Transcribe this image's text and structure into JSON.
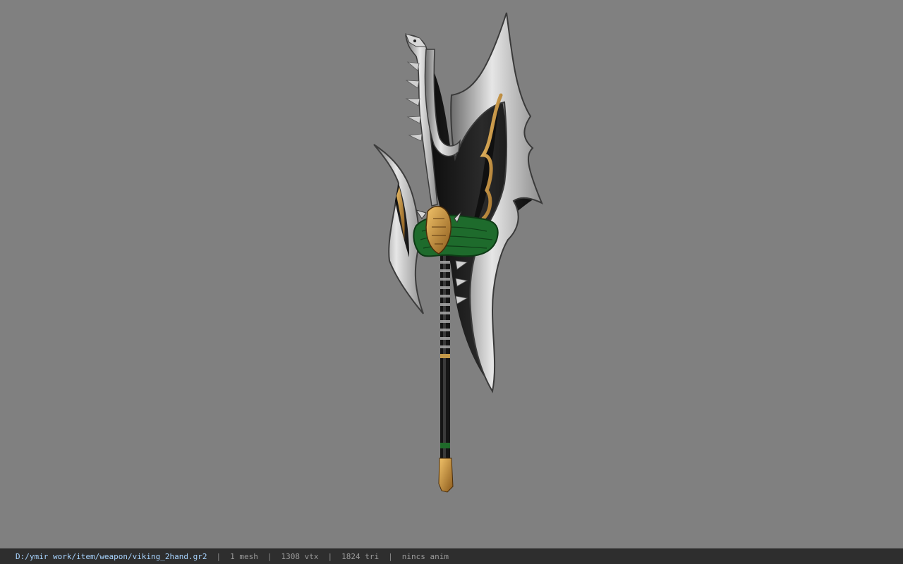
{
  "viewer": {
    "background_color": "#808080",
    "model_icon": "viking-two-handed-axe-model"
  },
  "status_bar": {
    "file_path": "D:/ymir work/item/weapon/viking_2hand.gr2",
    "separator": "|",
    "mesh_count": "1 mesh",
    "vertex_count": "1308 vtx",
    "triangle_count": "1824 tri",
    "animation": "nincs anim",
    "path_color": "#a8d4ff"
  }
}
